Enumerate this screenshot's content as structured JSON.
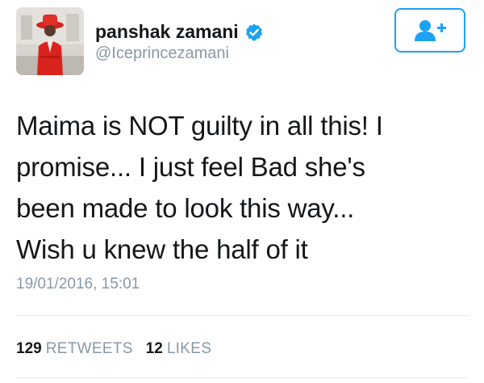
{
  "user": {
    "name": "panshak zamani",
    "handle": "@Iceprincezamani",
    "verified": true,
    "avatar_icon": "profile-photo"
  },
  "follow_button": {
    "icon": "follow-user-plus-icon"
  },
  "tweet": {
    "lines": [
      "Maima is NOT guilty in all this! I",
      "promise... I just feel Bad she's",
      "been made to look this way...",
      "Wish u knew the half of it"
    ],
    "timestamp": "19/01/2016, 15:01"
  },
  "stats": {
    "retweets_count": "129",
    "retweets_label": "RETWEETS",
    "likes_count": "12",
    "likes_label": "LIKES"
  },
  "colors": {
    "accent": "#1da1f2",
    "text": "#14171a",
    "muted": "#8899a6",
    "divider": "#e1e8ed"
  }
}
